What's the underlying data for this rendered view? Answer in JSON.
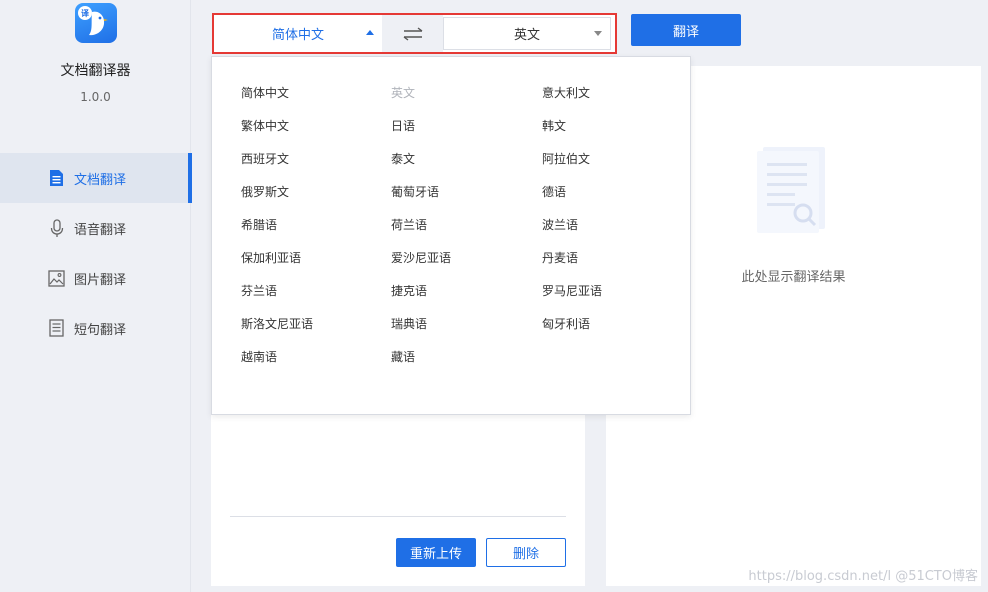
{
  "app": {
    "name": "文档翻译器",
    "version": "1.0.0",
    "logo_badge": "译",
    "logo_icon": "bird-logo"
  },
  "sidebar": {
    "items": [
      {
        "label": "文档翻译",
        "icon": "document-icon",
        "active": true
      },
      {
        "label": "语音翻译",
        "icon": "microphone-icon",
        "active": false
      },
      {
        "label": "图片翻译",
        "icon": "image-icon",
        "active": false
      },
      {
        "label": "短句翻译",
        "icon": "text-lines-icon",
        "active": false
      }
    ]
  },
  "toolbar": {
    "source_lang": "简体中文",
    "target_lang": "英文",
    "swap_icon": "swap-arrows-icon",
    "translate_label": "翻译"
  },
  "dropdown": {
    "languages": [
      {
        "label": "简体中文",
        "disabled": false
      },
      {
        "label": "英文",
        "disabled": true
      },
      {
        "label": "意大利文",
        "disabled": false
      },
      {
        "label": "繁体中文",
        "disabled": false
      },
      {
        "label": "日语",
        "disabled": false
      },
      {
        "label": "韩文",
        "disabled": false
      },
      {
        "label": "西班牙文",
        "disabled": false
      },
      {
        "label": "泰文",
        "disabled": false
      },
      {
        "label": "阿拉伯文",
        "disabled": false
      },
      {
        "label": "俄罗斯文",
        "disabled": false
      },
      {
        "label": "葡萄牙语",
        "disabled": false
      },
      {
        "label": "德语",
        "disabled": false
      },
      {
        "label": "希腊语",
        "disabled": false
      },
      {
        "label": "荷兰语",
        "disabled": false
      },
      {
        "label": "波兰语",
        "disabled": false
      },
      {
        "label": "保加利亚语",
        "disabled": false
      },
      {
        "label": "爱沙尼亚语",
        "disabled": false
      },
      {
        "label": "丹麦语",
        "disabled": false
      },
      {
        "label": "芬兰语",
        "disabled": false
      },
      {
        "label": "捷克语",
        "disabled": false
      },
      {
        "label": "罗马尼亚语",
        "disabled": false
      },
      {
        "label": "斯洛文尼亚语",
        "disabled": false
      },
      {
        "label": "瑞典语",
        "disabled": false
      },
      {
        "label": "匈牙利语",
        "disabled": false
      },
      {
        "label": "越南语",
        "disabled": false
      },
      {
        "label": "藏语",
        "disabled": false
      }
    ]
  },
  "result": {
    "empty_text": "此处显示翻译结果",
    "empty_icon": "document-search-icon"
  },
  "actions": {
    "reupload_label": "重新上传",
    "delete_label": "删除"
  },
  "watermark": "https://blog.csdn.net/l @51CTO博客",
  "colors": {
    "accent": "#1f6fe6",
    "highlight_border": "#e53935",
    "sidebar_bg": "#eef0f5"
  }
}
